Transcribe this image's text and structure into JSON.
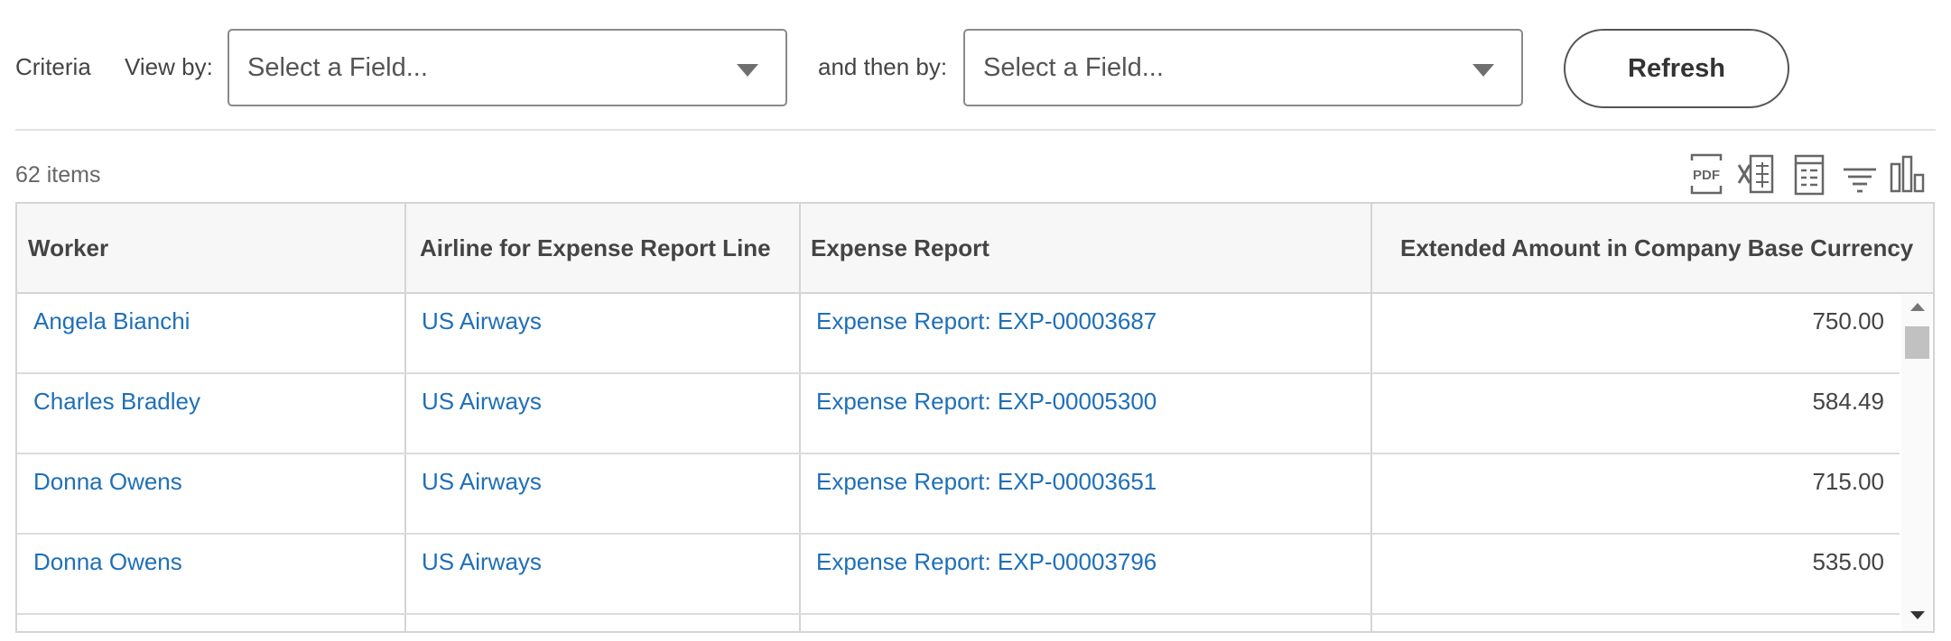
{
  "criteria": {
    "label": "Criteria",
    "view_by_label": "View by:",
    "view_by_value": "Select a Field...",
    "then_by_label": "and then by:",
    "then_by_value": "Select a Field...",
    "refresh_label": "Refresh"
  },
  "grid": {
    "item_count": "62 items",
    "toolbar_icons": [
      "pdf-export-icon",
      "excel-export-icon",
      "table-view-icon",
      "filter-icon",
      "chart-view-icon"
    ],
    "columns": [
      "Worker",
      "Airline for Expense Report Line",
      "Expense Report",
      "Extended Amount in Company Base Currency"
    ],
    "rows": [
      {
        "worker": "Angela Bianchi",
        "airline": "US Airways",
        "report": "Expense Report: EXP-00003687",
        "amount": "750.00"
      },
      {
        "worker": "Charles Bradley",
        "airline": "US Airways",
        "report": "Expense Report: EXP-00005300",
        "amount": "584.49"
      },
      {
        "worker": "Donna Owens",
        "airline": "US Airways",
        "report": "Expense Report: EXP-00003651",
        "amount": "715.00"
      },
      {
        "worker": "Donna Owens",
        "airline": "US Airways",
        "report": "Expense Report: EXP-00003796",
        "amount": "535.00"
      }
    ]
  },
  "colors": {
    "link": "#1f6fb8",
    "header_bg": "#f7f7f7",
    "border": "#d4d4d4"
  }
}
